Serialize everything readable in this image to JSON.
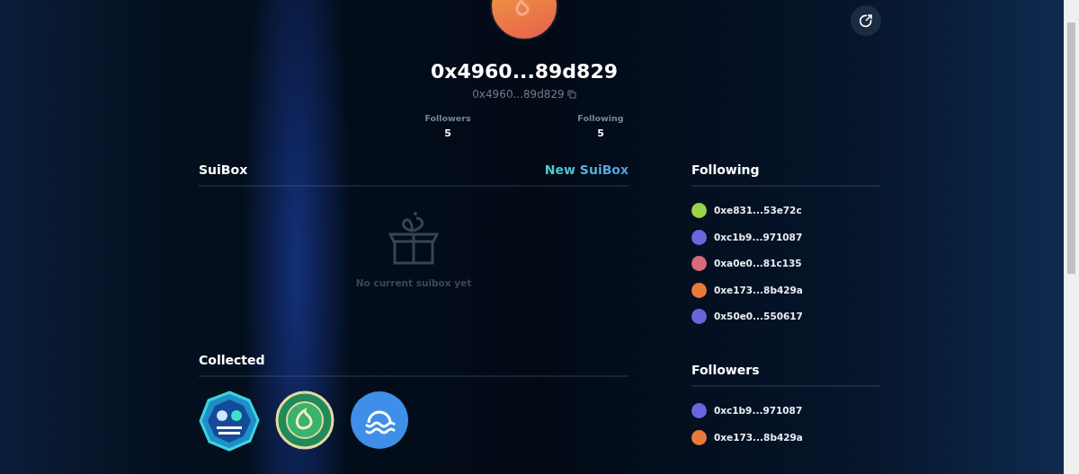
{
  "profile": {
    "name": "0x4960...89d829",
    "address": "0x4960...89d829"
  },
  "stats": [
    {
      "label": "Followers",
      "value": "5"
    },
    {
      "label": "Following",
      "value": "5"
    }
  ],
  "suibox": {
    "title": "SuiBox",
    "action": "New SuiBox",
    "empty_text": "No current suibox yet"
  },
  "collected": {
    "title": "Collected",
    "items": [
      {
        "kind": "octagon"
      },
      {
        "kind": "coin"
      },
      {
        "kind": "wave"
      }
    ]
  },
  "following": {
    "title": "Following",
    "items": [
      {
        "address": "0xe831...53e72c",
        "color": "#9ad44c"
      },
      {
        "address": "0xc1b9...971087",
        "color": "#6b66e0"
      },
      {
        "address": "0xa0e0...81c135",
        "color": "#d8687c"
      },
      {
        "address": "0xe173...8b429a",
        "color": "#ea7a3c"
      },
      {
        "address": "0x50e0...550617",
        "color": "#6e62dc"
      }
    ]
  },
  "followers": {
    "title": "Followers",
    "items": [
      {
        "address": "0xc1b9...971087",
        "color": "#6b66e0"
      },
      {
        "address": "0xe173...8b429a",
        "color": "#ea7a3c"
      }
    ]
  }
}
